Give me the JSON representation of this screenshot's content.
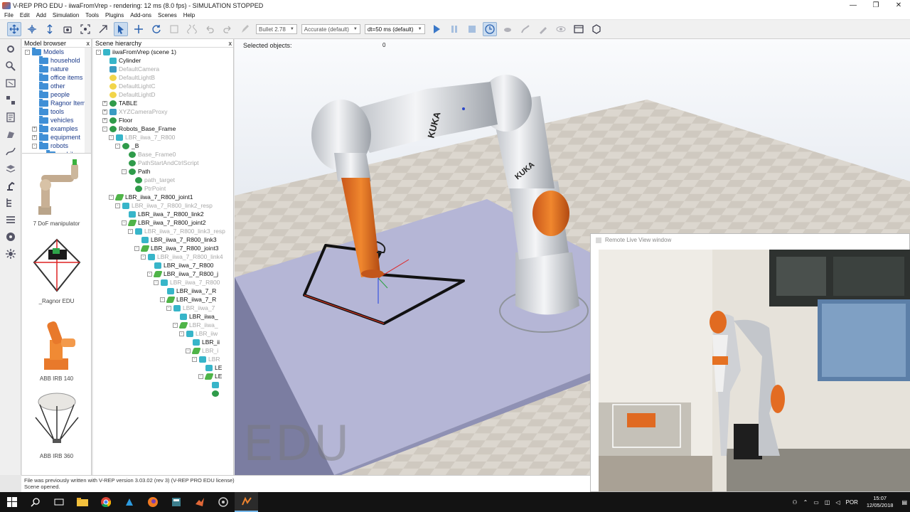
{
  "window": {
    "title": "V-REP PRO EDU - iiwaFromVrep - rendering: 12 ms (8.0 fps) - SIMULATION STOPPED",
    "minimize": "—",
    "maximize": "❐",
    "close": "✕"
  },
  "menu": [
    "File",
    "Edit",
    "Add",
    "Simulation",
    "Tools",
    "Plugins",
    "Add-ons",
    "Scenes",
    "Help"
  ],
  "toolbar": {
    "engine": "Bullet 2.78",
    "accuracy": "Accurate (default)",
    "timestep": "dt=50 ms (default)"
  },
  "model_browser": {
    "title": "Model browser",
    "close": "x",
    "tree": [
      {
        "label": "Models",
        "level": 0,
        "expander": "-"
      },
      {
        "label": "household",
        "level": 1,
        "expander": ""
      },
      {
        "label": "nature",
        "level": 1,
        "expander": ""
      },
      {
        "label": "office items",
        "level": 1,
        "expander": ""
      },
      {
        "label": "other",
        "level": 1,
        "expander": ""
      },
      {
        "label": "people",
        "level": 1,
        "expander": ""
      },
      {
        "label": "Ragnor Item",
        "level": 1,
        "expander": ""
      },
      {
        "label": "tools",
        "level": 1,
        "expander": ""
      },
      {
        "label": "vehicles",
        "level": 1,
        "expander": ""
      },
      {
        "label": "examples",
        "level": 1,
        "expander": "+"
      },
      {
        "label": "equipment",
        "level": 1,
        "expander": "+"
      },
      {
        "label": "robots",
        "level": 1,
        "expander": "-"
      },
      {
        "label": "mobile",
        "level": 2,
        "expander": ""
      }
    ],
    "thumbnails": [
      "7 DoF manipulator",
      "_Ragnor EDU",
      "ABB IRB 140",
      "ABB IRB 360"
    ]
  },
  "scene_hierarchy": {
    "title": "Scene hierarchy",
    "close": "x",
    "items": [
      {
        "label": "iiwaFromVrep (scene 1)",
        "level": 0,
        "icon": "scene",
        "dim": false,
        "exp": "-"
      },
      {
        "label": "Cylinder",
        "level": 1,
        "icon": "shape",
        "dim": false,
        "exp": ""
      },
      {
        "label": "DefaultCamera",
        "level": 1,
        "icon": "cam",
        "dim": true,
        "exp": ""
      },
      {
        "label": "DefaultLightB",
        "level": 1,
        "icon": "light",
        "dim": true,
        "exp": ""
      },
      {
        "label": "DefaultLightC",
        "level": 1,
        "icon": "light",
        "dim": true,
        "exp": ""
      },
      {
        "label": "DefaultLightD",
        "level": 1,
        "icon": "light",
        "dim": true,
        "exp": ""
      },
      {
        "label": "TABLE",
        "level": 1,
        "icon": "dummy",
        "dim": false,
        "exp": "+"
      },
      {
        "label": "XYZCameraProxy",
        "level": 1,
        "icon": "cam",
        "dim": true,
        "exp": "+"
      },
      {
        "label": "Floor",
        "level": 1,
        "icon": "dummy",
        "dim": false,
        "exp": "+"
      },
      {
        "label": "Robots_Base_Frame",
        "level": 1,
        "icon": "dummy",
        "dim": false,
        "exp": "-"
      },
      {
        "label": "LBR_iiwa_7_R800",
        "level": 2,
        "icon": "shape",
        "dim": true,
        "exp": "-"
      },
      {
        "label": "_B",
        "level": 3,
        "icon": "dummy",
        "dim": false,
        "exp": "-"
      },
      {
        "label": "Base_Frame0",
        "level": 4,
        "icon": "dummy",
        "dim": true,
        "exp": ""
      },
      {
        "label": "PathStartAndCtrlScript",
        "level": 4,
        "icon": "dummy",
        "dim": true,
        "exp": ""
      },
      {
        "label": "Path",
        "level": 4,
        "icon": "dummy",
        "dim": false,
        "exp": "-"
      },
      {
        "label": "path_target",
        "level": 5,
        "icon": "dummy",
        "dim": true,
        "exp": ""
      },
      {
        "label": "PtrPoint",
        "level": 5,
        "icon": "dummy",
        "dim": true,
        "exp": ""
      },
      {
        "label": "LBR_iiwa_7_R800_joint1",
        "level": 2,
        "icon": "joint",
        "dim": false,
        "exp": "-"
      },
      {
        "label": "LBR_iiwa_7_R800_link2_resp",
        "level": 3,
        "icon": "shape",
        "dim": true,
        "exp": "-"
      },
      {
        "label": "LBR_iiwa_7_R800_link2",
        "level": 4,
        "icon": "shape",
        "dim": false,
        "exp": ""
      },
      {
        "label": "LBR_iiwa_7_R800_joint2",
        "level": 4,
        "icon": "joint",
        "dim": false,
        "exp": "-"
      },
      {
        "label": "LBR_iiwa_7_R800_link3_resp",
        "level": 5,
        "icon": "shape",
        "dim": true,
        "exp": "-"
      },
      {
        "label": "LBR_iiwa_7_R800_link3",
        "level": 6,
        "icon": "shape",
        "dim": false,
        "exp": ""
      },
      {
        "label": "LBR_iiwa_7_R800_joint3",
        "level": 6,
        "icon": "joint",
        "dim": false,
        "exp": "-"
      },
      {
        "label": "LBR_iiwa_7_R800_link4",
        "level": 7,
        "icon": "shape",
        "dim": true,
        "exp": "-"
      },
      {
        "label": "LBR_iiwa_7_R800",
        "level": 8,
        "icon": "shape",
        "dim": false,
        "exp": ""
      },
      {
        "label": "LBR_iiwa_7_R800_j",
        "level": 8,
        "icon": "joint",
        "dim": false,
        "exp": "-"
      },
      {
        "label": "LBR_iiwa_7_R800",
        "level": 9,
        "icon": "shape",
        "dim": true,
        "exp": "-"
      },
      {
        "label": "LBR_iiwa_7_R",
        "level": 10,
        "icon": "shape",
        "dim": false,
        "exp": ""
      },
      {
        "label": "LBR_iiwa_7_R",
        "level": 10,
        "icon": "joint",
        "dim": false,
        "exp": "-"
      },
      {
        "label": "LBR_iiwa_7",
        "level": 11,
        "icon": "shape",
        "dim": true,
        "exp": "-"
      },
      {
        "label": "LBR_iiwa_",
        "level": 12,
        "icon": "shape",
        "dim": false,
        "exp": ""
      },
      {
        "label": "LBR_iiwa_",
        "level": 12,
        "icon": "joint",
        "dim": true,
        "exp": "-"
      },
      {
        "label": "LBR_iiw",
        "level": 13,
        "icon": "shape",
        "dim": true,
        "exp": "-"
      },
      {
        "label": "LBR_ii",
        "level": 14,
        "icon": "shape",
        "dim": false,
        "exp": ""
      },
      {
        "label": "LBR_i",
        "level": 14,
        "icon": "joint",
        "dim": true,
        "exp": "-"
      },
      {
        "label": "LBR",
        "level": 15,
        "icon": "shape",
        "dim": true,
        "exp": "-"
      },
      {
        "label": "LE",
        "level": 16,
        "icon": "shape",
        "dim": false,
        "exp": ""
      },
      {
        "label": "LE",
        "level": 16,
        "icon": "joint",
        "dim": false,
        "exp": "-"
      },
      {
        "label": "",
        "level": 17,
        "icon": "shape",
        "dim": false,
        "exp": ""
      },
      {
        "label": "",
        "level": 17,
        "icon": "dummy",
        "dim": false,
        "exp": ""
      }
    ]
  },
  "viewport": {
    "selected_label": "Selected objects:",
    "selected_count": "0",
    "watermark": "EDU",
    "brand": "KUKA"
  },
  "remote_window": {
    "title": "Remote Live View window"
  },
  "status": {
    "line1": "File was previously written with V-REP version 3.03.02 (rev 3) (V-REP PRO EDU license)",
    "line2": "Scene opened."
  },
  "taskbar": {
    "lang": "POR",
    "time": "15:07",
    "date": "12/05/2018"
  },
  "colors": {
    "accent_orange": "#e8731f",
    "floor_tile": "#d8d3cb",
    "table_top": "#b3b4d4"
  }
}
